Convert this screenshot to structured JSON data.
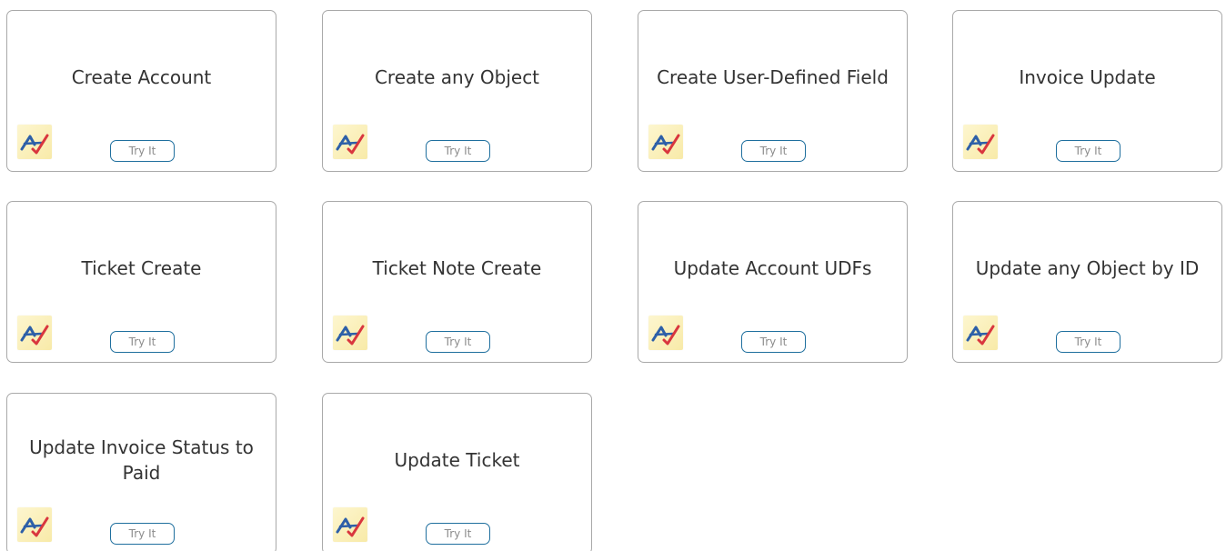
{
  "cards": [
    {
      "title": "Create Account",
      "button": "Try It",
      "logo": "autotask-logo-icon"
    },
    {
      "title": "Create any Object",
      "button": "Try It",
      "logo": "autotask-logo-icon"
    },
    {
      "title": "Create User-Defined Field",
      "button": "Try It",
      "logo": "autotask-logo-icon"
    },
    {
      "title": "Invoice Update",
      "button": "Try It",
      "logo": "autotask-logo-icon"
    },
    {
      "title": "Ticket Create",
      "button": "Try It",
      "logo": "autotask-logo-icon"
    },
    {
      "title": "Ticket Note Create",
      "button": "Try It",
      "logo": "autotask-logo-icon"
    },
    {
      "title": "Update Account UDFs",
      "button": "Try It",
      "logo": "autotask-logo-icon"
    },
    {
      "title": "Update any Object by ID",
      "button": "Try It",
      "logo": "autotask-logo-icon"
    },
    {
      "title": "Update Invoice Status to Paid",
      "button": "Try It",
      "logo": "autotask-logo-icon"
    },
    {
      "title": "Update Ticket",
      "button": "Try It",
      "logo": "autotask-logo-icon"
    }
  ],
  "colors": {
    "card_border": "#a9a9a9",
    "button_border": "#1f6f9e",
    "button_text": "#8c8c8c",
    "title_text": "#333333",
    "logo_background": "#fdf6cf",
    "logo_red": "#d9363e",
    "logo_blue": "#2d5fa8"
  }
}
